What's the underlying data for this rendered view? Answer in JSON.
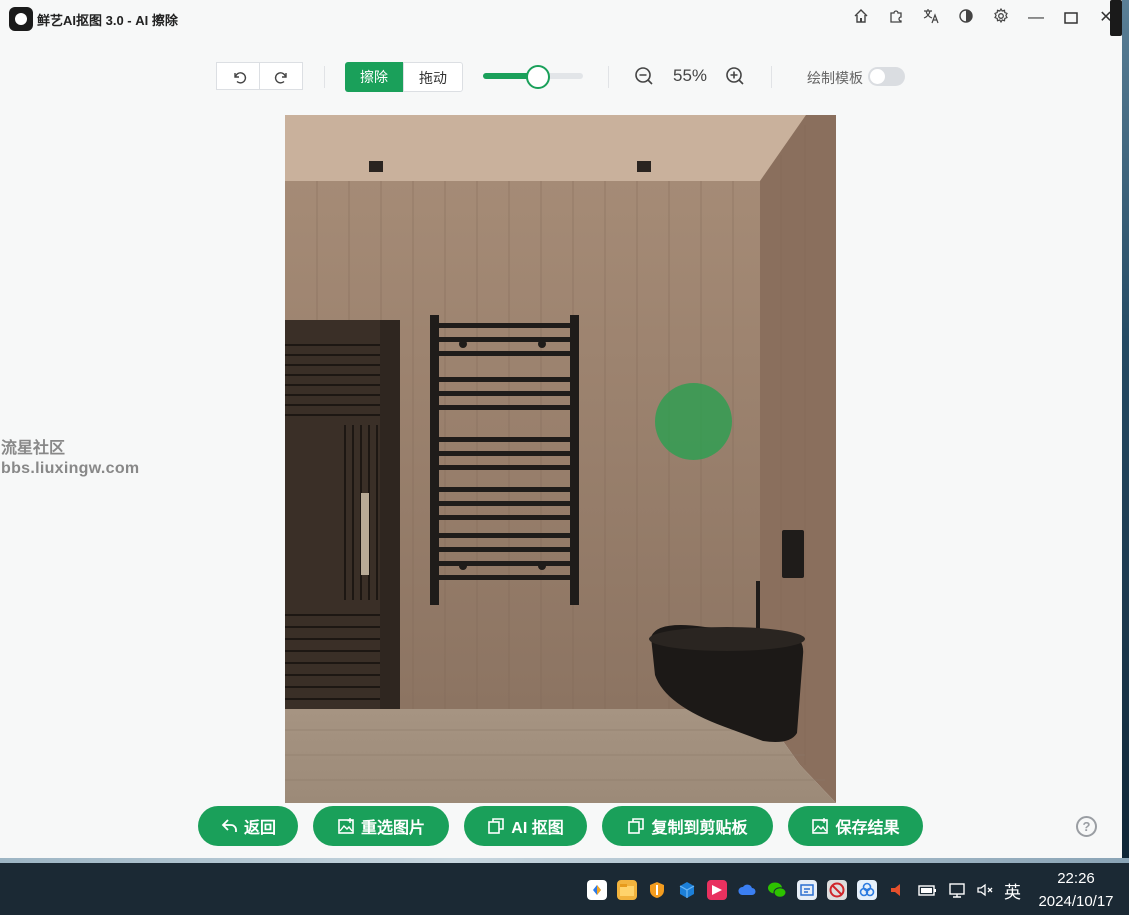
{
  "app": {
    "title": "鲜艺AI抠图  3.0 - AI 擦除"
  },
  "title_bar_icons": [
    "home-icon",
    "puzzle-icon",
    "translate-icon",
    "theme-icon",
    "gear-icon"
  ],
  "window_controls": {
    "minimize": "—",
    "maximize": "☐",
    "close": "✕"
  },
  "toolbar": {
    "mode_erase": "擦除",
    "mode_drag": "拖动",
    "brush_size_fraction": 0.54,
    "zoom_level": "55%",
    "template_label": "绘制模板",
    "template_toggle_on": false
  },
  "watermark": {
    "line1": "流星社区",
    "line2": "bbs.liuxingw.com"
  },
  "actions": {
    "back": "返回",
    "reselect": "重选图片",
    "ai_cutout": "AI 抠图",
    "copy_clipboard": "复制到剪贴板",
    "save_result": "保存结果"
  },
  "taskbar": {
    "ime": "英",
    "time": "22:26",
    "date": "2024/10/17"
  },
  "colors": {
    "accent": "#1aa05a",
    "taskbar": "#1b2934"
  }
}
